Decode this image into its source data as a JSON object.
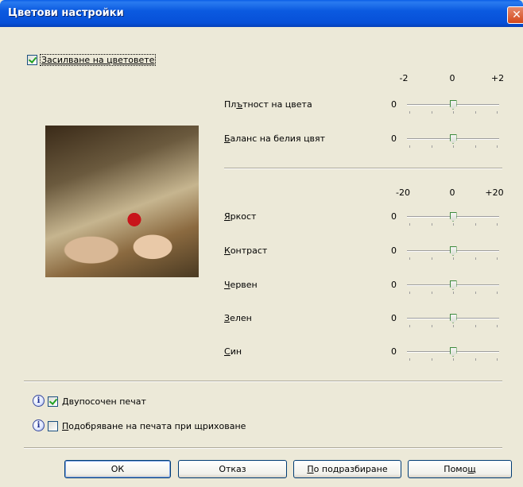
{
  "window": {
    "title": "Цветови настройки",
    "close_glyph": "✕"
  },
  "enhancement": {
    "label": "Засилване на цветовете",
    "checked": true
  },
  "photo": {
    "icon": "kitchen-photo"
  },
  "density_scale": {
    "min": "-2",
    "mid": "0",
    "max": "+2"
  },
  "top_sliders": [
    {
      "prefix": "Пл",
      "mnemonic": "ъ",
      "suffix": "тност на цвета",
      "value": "0",
      "level": 0
    },
    {
      "prefix": "",
      "mnemonic": "Б",
      "suffix": "аланс на белия цвят",
      "value": "0",
      "level": 0
    }
  ],
  "color_scale": {
    "min": "-20",
    "mid": "0",
    "max": "+20"
  },
  "bottom_sliders": [
    {
      "prefix": "",
      "mnemonic": "Я",
      "suffix": "ркост",
      "value": "0",
      "level": 0
    },
    {
      "prefix": "",
      "mnemonic": "К",
      "suffix": "онтраст",
      "value": "0",
      "level": 0
    },
    {
      "prefix": "",
      "mnemonic": "Ч",
      "suffix": "ервен",
      "value": "0",
      "level": 0
    },
    {
      "prefix": "",
      "mnemonic": "З",
      "suffix": "елен",
      "value": "0",
      "level": 0
    },
    {
      "prefix": "",
      "mnemonic": "С",
      "suffix": "ин",
      "value": "0",
      "level": 0
    }
  ],
  "options": [
    {
      "mnemonic": "Д",
      "suffix": "вупосочен печат",
      "checked": true,
      "icon": "info-icon"
    },
    {
      "mnemonic": "П",
      "suffix": "одобряване на печата при щриховане",
      "checked": false,
      "icon": "info-icon"
    }
  ],
  "buttons": {
    "ok": "ОК",
    "cancel": "Отказ",
    "default_prefix": "",
    "default_mnemonic": "П",
    "default_suffix": "о подразбиране",
    "help_prefix": "Помо",
    "help_mnemonic": "щ",
    "help_suffix": ""
  },
  "colors": {
    "title_bar": "#0b5ae0",
    "face": "#ece9d8",
    "check": "#21a121"
  }
}
